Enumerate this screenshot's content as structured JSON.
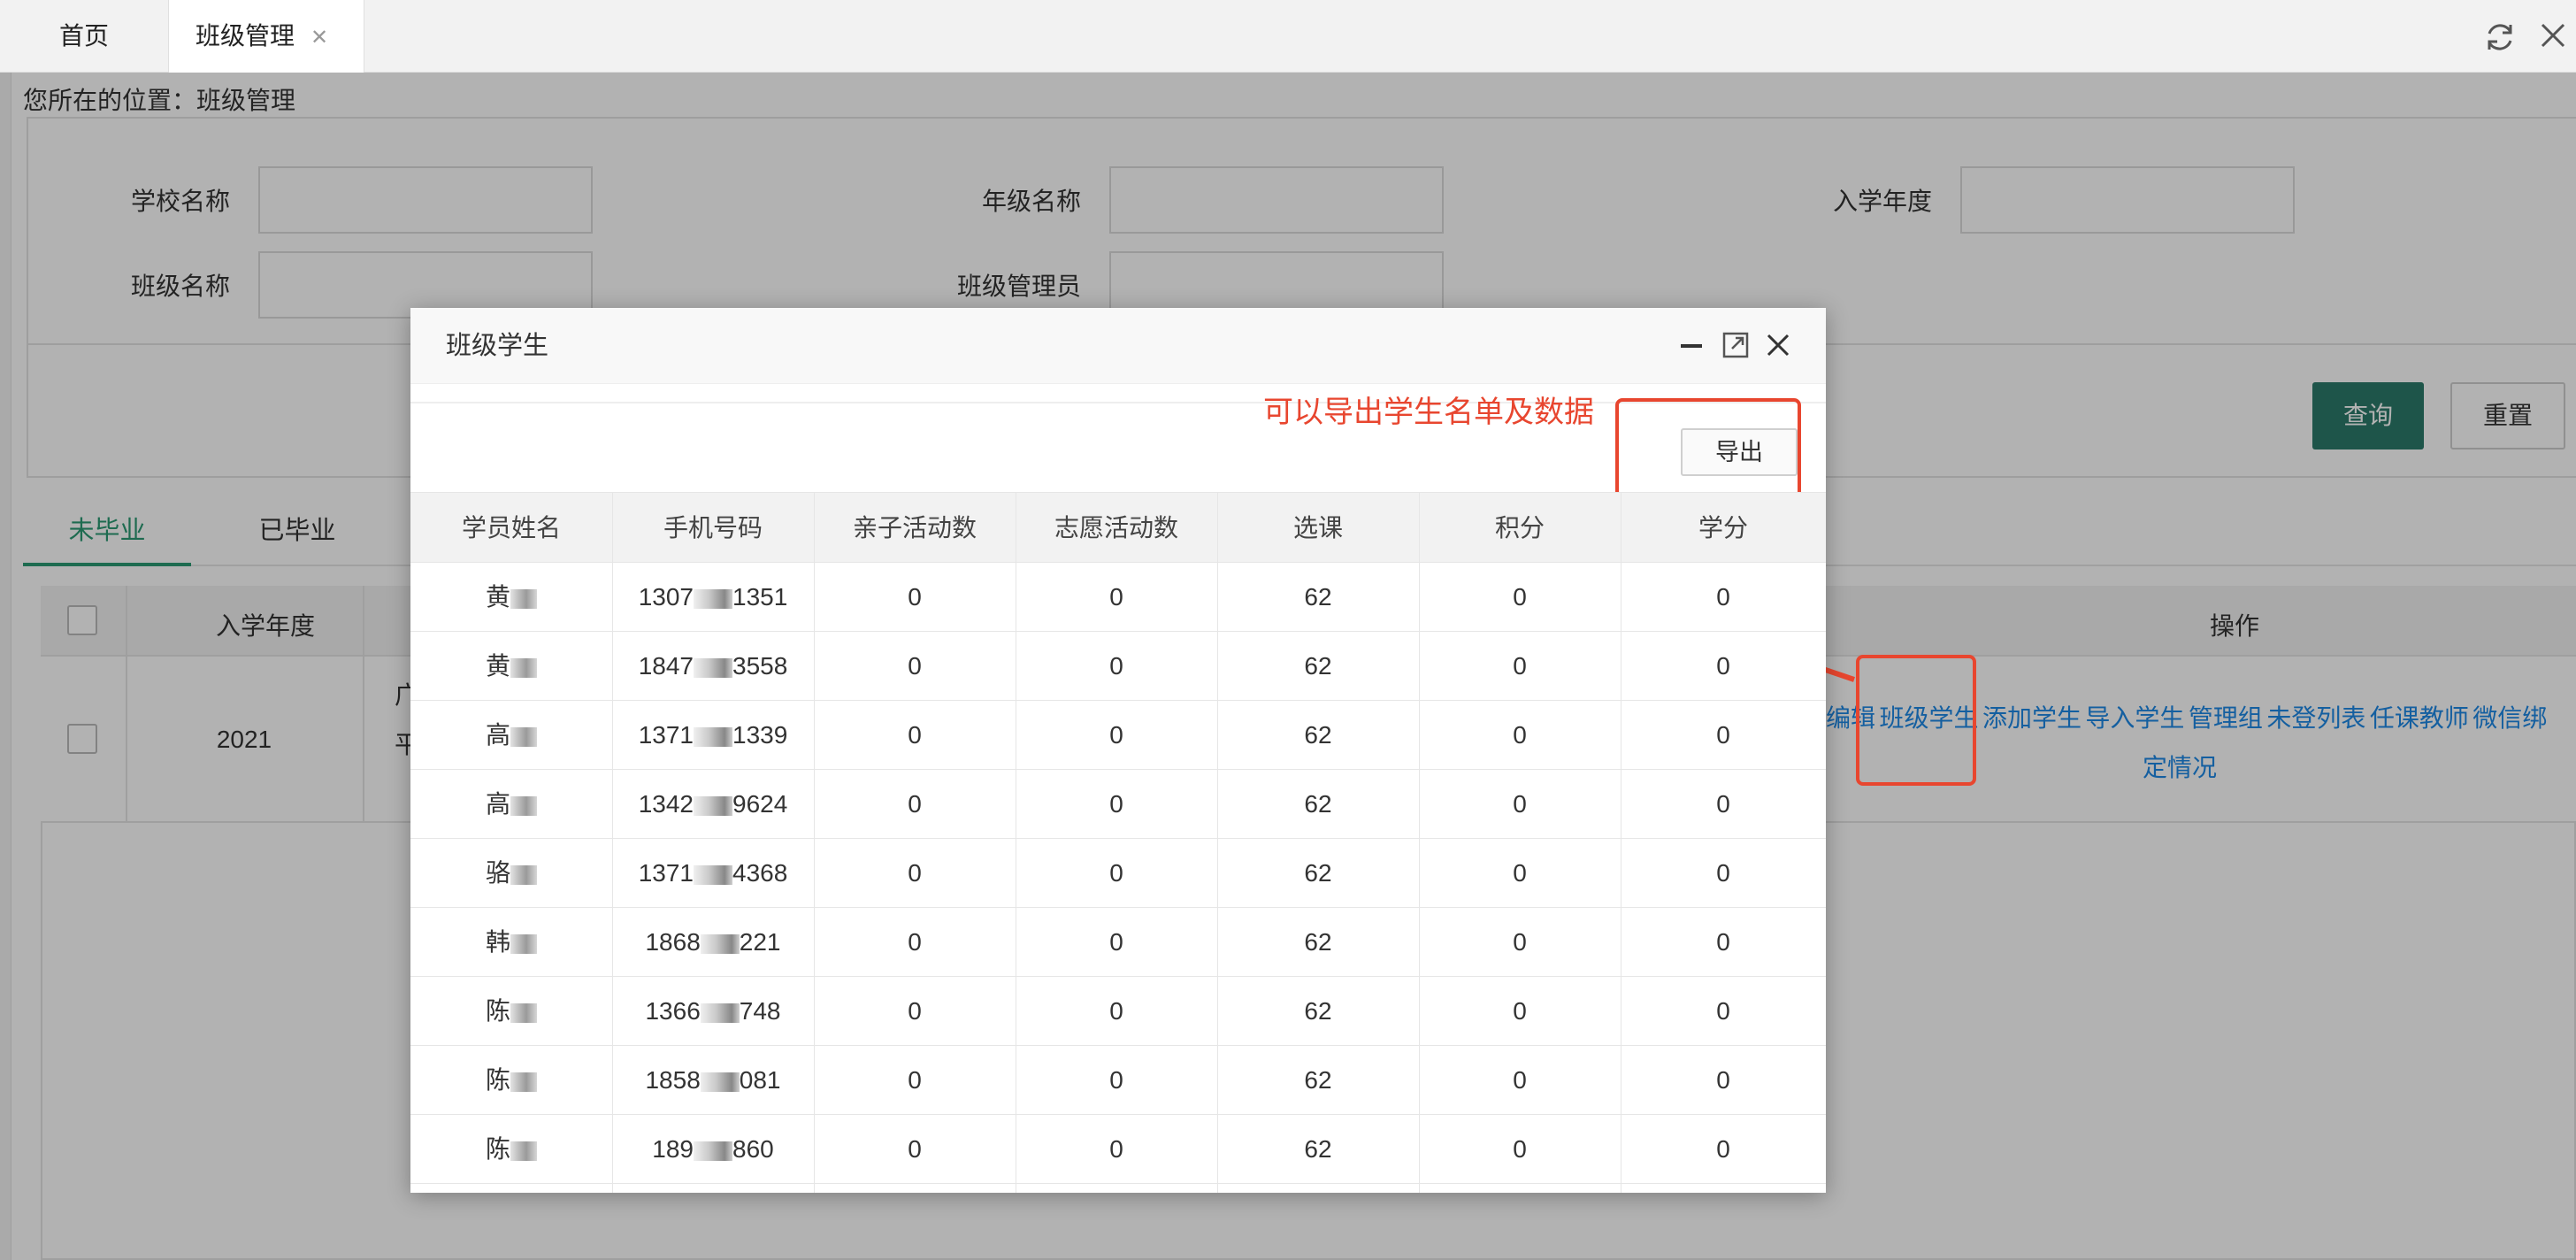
{
  "tabs": {
    "home": "首页",
    "class_mgmt": "班级管理"
  },
  "breadcrumb": "您所在的位置：班级管理",
  "filters": {
    "school_name": "学校名称",
    "grade_name": "年级名称",
    "enroll_year": "入学年度",
    "class_name": "班级名称",
    "class_admin": "班级管理员"
  },
  "buttons": {
    "query": "查询",
    "reset": "重置"
  },
  "status_tabs": {
    "not_graduated": "未毕业",
    "graduated": "已毕业"
  },
  "main_table": {
    "head_enroll_year": "入学年度",
    "head_ops": "操作",
    "row_year": "2021",
    "row_school_fragment_1": "广",
    "row_school_fragment_2": "平",
    "ops_line1": [
      "编辑",
      "班级学生",
      "添加学生",
      "导入学生",
      "管理组",
      "未登列表",
      "任课教师",
      "微信绑"
    ],
    "ops_line2": "定情况"
  },
  "modal": {
    "title": "班级学生",
    "annotation": "可以导出学生名单及数据",
    "export": "导出",
    "headers": [
      "学员姓名",
      "手机号码",
      "亲子活动数",
      "志愿活动数",
      "选课",
      "积分",
      "学分"
    ],
    "rows": [
      {
        "name": "黄",
        "phone_start": "1307",
        "phone_end": "1351",
        "parent": "0",
        "volunteer": "0",
        "courses": "62",
        "points": "0",
        "credits": "0"
      },
      {
        "name": "黄",
        "phone_start": "1847",
        "phone_end": "3558",
        "parent": "0",
        "volunteer": "0",
        "courses": "62",
        "points": "0",
        "credits": "0"
      },
      {
        "name": "高",
        "phone_start": "1371",
        "phone_end": "1339",
        "parent": "0",
        "volunteer": "0",
        "courses": "62",
        "points": "0",
        "credits": "0"
      },
      {
        "name": "高",
        "phone_start": "1342",
        "phone_end": "9624",
        "parent": "0",
        "volunteer": "0",
        "courses": "62",
        "points": "0",
        "credits": "0"
      },
      {
        "name": "骆",
        "phone_start": "1371",
        "phone_end": "4368",
        "parent": "0",
        "volunteer": "0",
        "courses": "62",
        "points": "0",
        "credits": "0"
      },
      {
        "name": "韩",
        "phone_start": "1868",
        "phone_end": "221",
        "parent": "0",
        "volunteer": "0",
        "courses": "62",
        "points": "0",
        "credits": "0"
      },
      {
        "name": "陈",
        "phone_start": "1366",
        "phone_end": "748",
        "parent": "0",
        "volunteer": "0",
        "courses": "62",
        "points": "0",
        "credits": "0"
      },
      {
        "name": "陈",
        "phone_start": "1858",
        "phone_end": "081",
        "parent": "0",
        "volunteer": "0",
        "courses": "62",
        "points": "0",
        "credits": "0"
      },
      {
        "name": "陈",
        "phone_start": "189",
        "phone_end": "860",
        "parent": "0",
        "volunteer": "0",
        "courses": "62",
        "points": "0",
        "credits": "0"
      }
    ]
  },
  "colors": {
    "accent": "#2b7a6a",
    "tab_active": "#2b9a73",
    "link": "#1e88e5",
    "annotation": "#e8462f"
  }
}
